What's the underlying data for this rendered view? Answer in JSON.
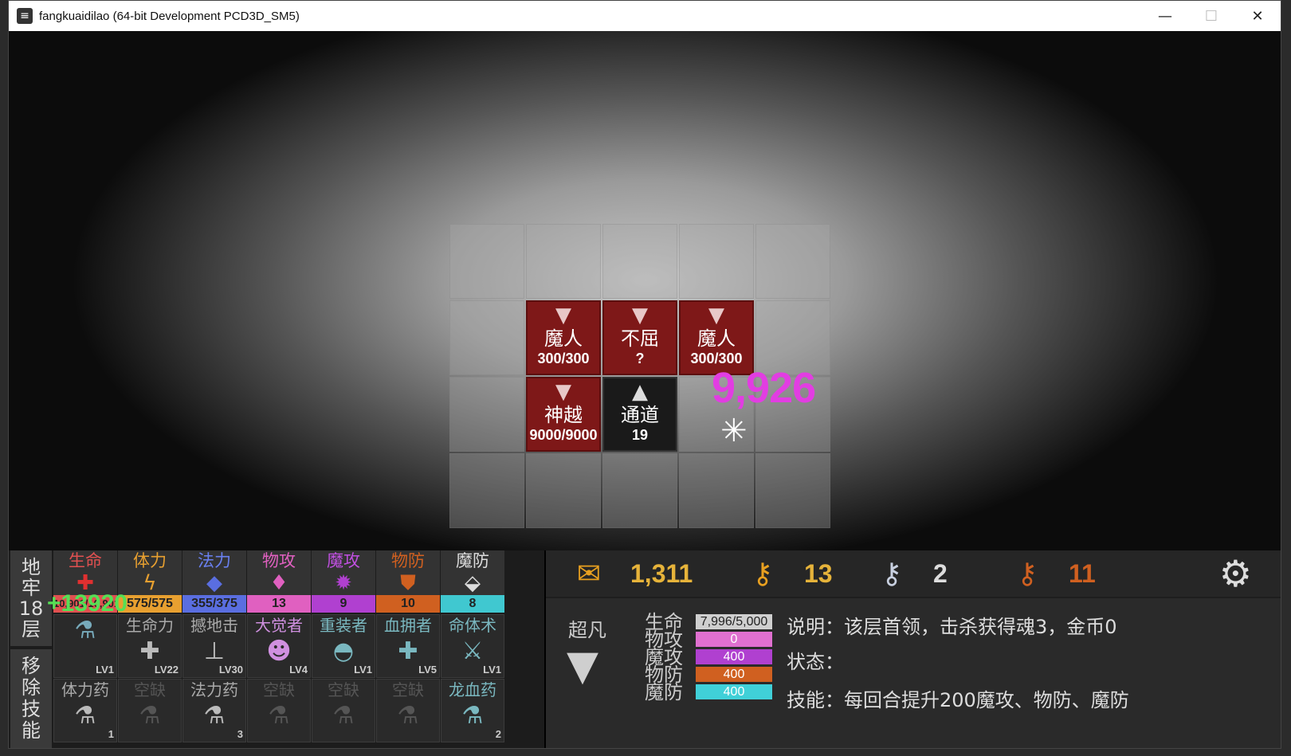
{
  "window": {
    "title": "fangkuaidilao (64-bit Development PCD3D_SM5)",
    "min": "—",
    "max": "☐",
    "close": "✕"
  },
  "grid": {
    "cells": [
      {
        "name": "魔人",
        "hp": "300/300",
        "icon": "demon-icon"
      },
      {
        "name": "不屈",
        "hp": "?",
        "icon": "demon-icon"
      },
      {
        "name": "魔人",
        "hp": "300/300",
        "icon": "demon-icon"
      },
      {
        "name": "神越",
        "hp": "9000/9000",
        "icon": "demon-icon"
      },
      {
        "name": "通道",
        "hp": "19",
        "icon": "up-arrow-icon"
      }
    ],
    "damage": "9,926"
  },
  "hud": {
    "floor": [
      "地",
      "牢",
      "18",
      "层"
    ],
    "remove_skill": [
      "移",
      "除",
      "技",
      "能"
    ],
    "gain": "+13920",
    "stats": [
      {
        "label": "生命",
        "value": "10,901/10,901",
        "color": "#e05050",
        "icon": "cross-icon"
      },
      {
        "label": "体力",
        "value": "575/575",
        "color": "#e8a030",
        "icon": "bolt-icon"
      },
      {
        "label": "法力",
        "value": "355/375",
        "color": "#5a6ee0",
        "icon": "diamond-icon"
      },
      {
        "label": "物攻",
        "value": "13",
        "color": "#e060c0",
        "icon": "sword-icon"
      },
      {
        "label": "魔攻",
        "value": "9",
        "color": "#b040d0",
        "icon": "magic-icon"
      },
      {
        "label": "物防",
        "value": "10",
        "color": "#d06020",
        "icon": "shield-icon"
      },
      {
        "label": "魔防",
        "value": "8",
        "color": "#40c8d0",
        "icon": "magic-shield-icon"
      }
    ],
    "skills": [
      {
        "label": "",
        "lv": "LV1"
      },
      {
        "label": "生命力",
        "lv": "LV22"
      },
      {
        "label": "撼地击",
        "lv": "LV30"
      },
      {
        "label": "大觉者",
        "lv": "LV4"
      },
      {
        "label": "重装者",
        "lv": "LV1"
      },
      {
        "label": "血拥者",
        "lv": "LV5"
      },
      {
        "label": "命体术",
        "lv": "LV1"
      }
    ],
    "items": [
      {
        "label": "体力药",
        "count": "1"
      },
      {
        "label": "空缺",
        "count": ""
      },
      {
        "label": "法力药",
        "count": "3"
      },
      {
        "label": "空缺",
        "count": ""
      },
      {
        "label": "空缺",
        "count": ""
      },
      {
        "label": "空缺",
        "count": ""
      },
      {
        "label": "龙血药",
        "count": "2"
      }
    ]
  },
  "resources": {
    "gold": "1,311",
    "key_gold": "13",
    "key_silver": "2",
    "key_bronze": "11"
  },
  "enemy": {
    "name": "超凡",
    "labels": {
      "hp": "生命",
      "atk": "物攻",
      "matk": "魔攻",
      "def": "物防",
      "mdef": "魔防"
    },
    "hp": "7,996/5,000",
    "atk": "0",
    "matk": "400",
    "def": "400",
    "mdef": "400",
    "desc": "说明：该层首领，击杀获得魂3，金币0",
    "status": "状态：",
    "skill": "技能：每回合提升200魔攻、物防、魔防"
  }
}
